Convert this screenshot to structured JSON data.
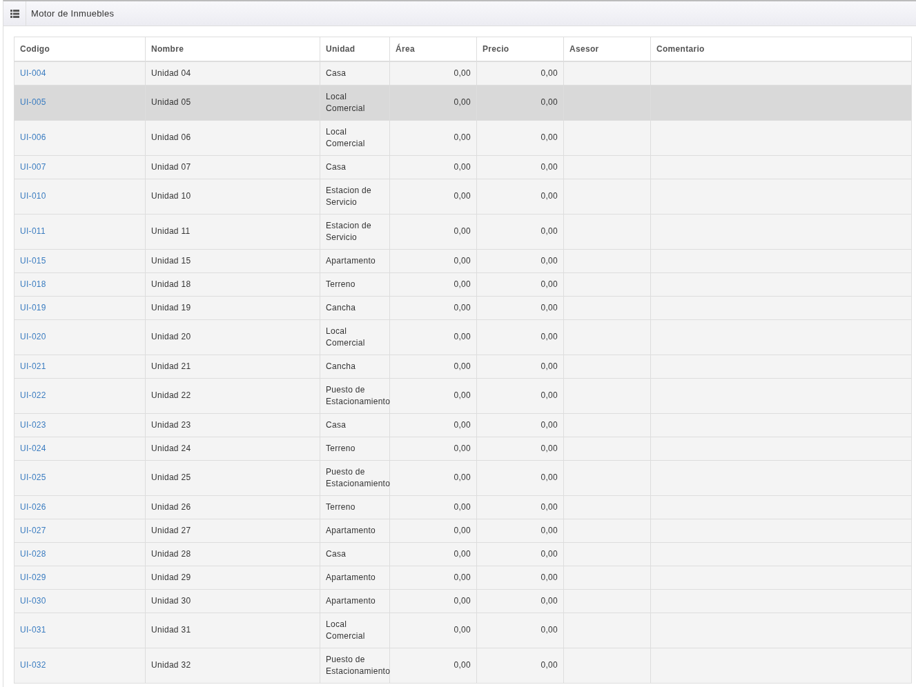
{
  "header": {
    "title": "Motor de Inmuebles"
  },
  "table": {
    "columns": [
      {
        "label": "Codigo"
      },
      {
        "label": "Nombre"
      },
      {
        "label": "Unidad"
      },
      {
        "label": "Área"
      },
      {
        "label": "Precio"
      },
      {
        "label": "Asesor"
      },
      {
        "label": "Comentario"
      }
    ],
    "rows": [
      {
        "code": "UI-004",
        "name": "Unidad 04",
        "unit": "Casa",
        "area": "0,00",
        "price": "0,00",
        "selected": false
      },
      {
        "code": "UI-005",
        "name": "Unidad 05",
        "unit": "Local Comercial",
        "area": "0,00",
        "price": "0,00",
        "selected": true
      },
      {
        "code": "UI-006",
        "name": "Unidad 06",
        "unit": "Local Comercial",
        "area": "0,00",
        "price": "0,00",
        "selected": false
      },
      {
        "code": "UI-007",
        "name": "Unidad 07",
        "unit": "Casa",
        "area": "0,00",
        "price": "0,00",
        "selected": false
      },
      {
        "code": "UI-010",
        "name": "Unidad 10",
        "unit": "Estacion de Servicio",
        "area": "0,00",
        "price": "0,00",
        "selected": false
      },
      {
        "code": "UI-011",
        "name": "Unidad 11",
        "unit": "Estacion de Servicio",
        "area": "0,00",
        "price": "0,00",
        "selected": false
      },
      {
        "code": "UI-015",
        "name": "Unidad 15",
        "unit": "Apartamento",
        "area": "0,00",
        "price": "0,00",
        "selected": false
      },
      {
        "code": "UI-018",
        "name": "Unidad 18",
        "unit": "Terreno",
        "area": "0,00",
        "price": "0,00",
        "selected": false
      },
      {
        "code": "UI-019",
        "name": "Unidad 19",
        "unit": "Cancha",
        "area": "0,00",
        "price": "0,00",
        "selected": false
      },
      {
        "code": "UI-020",
        "name": "Unidad 20",
        "unit": "Local Comercial",
        "area": "0,00",
        "price": "0,00",
        "selected": false
      },
      {
        "code": "UI-021",
        "name": "Unidad 21",
        "unit": "Cancha",
        "area": "0,00",
        "price": "0,00",
        "selected": false
      },
      {
        "code": "UI-022",
        "name": "Unidad 22",
        "unit": "Puesto de Estacionamiento",
        "area": "0,00",
        "price": "0,00",
        "selected": false
      },
      {
        "code": "UI-023",
        "name": "Unidad 23",
        "unit": "Casa",
        "area": "0,00",
        "price": "0,00",
        "selected": false
      },
      {
        "code": "UI-024",
        "name": "Unidad 24",
        "unit": "Terreno",
        "area": "0,00",
        "price": "0,00",
        "selected": false
      },
      {
        "code": "UI-025",
        "name": "Unidad 25",
        "unit": "Puesto de Estacionamiento",
        "area": "0,00",
        "price": "0,00",
        "selected": false
      },
      {
        "code": "UI-026",
        "name": "Unidad 26",
        "unit": "Terreno",
        "area": "0,00",
        "price": "0,00",
        "selected": false
      },
      {
        "code": "UI-027",
        "name": "Unidad 27",
        "unit": "Apartamento",
        "area": "0,00",
        "price": "0,00",
        "selected": false
      },
      {
        "code": "UI-028",
        "name": "Unidad 28",
        "unit": "Casa",
        "area": "0,00",
        "price": "0,00",
        "selected": false
      },
      {
        "code": "UI-029",
        "name": "Unidad 29",
        "unit": "Apartamento",
        "area": "0,00",
        "price": "0,00",
        "selected": false
      },
      {
        "code": "UI-030",
        "name": "Unidad 30",
        "unit": "Apartamento",
        "area": "0,00",
        "price": "0,00",
        "selected": false
      },
      {
        "code": "UI-031",
        "name": "Unidad 31",
        "unit": "Local Comercial",
        "area": "0,00",
        "price": "0,00",
        "selected": false
      },
      {
        "code": "UI-032",
        "name": "Unidad 32",
        "unit": "Puesto de Estacionamiento",
        "area": "0,00",
        "price": "0,00",
        "selected": false
      }
    ]
  }
}
